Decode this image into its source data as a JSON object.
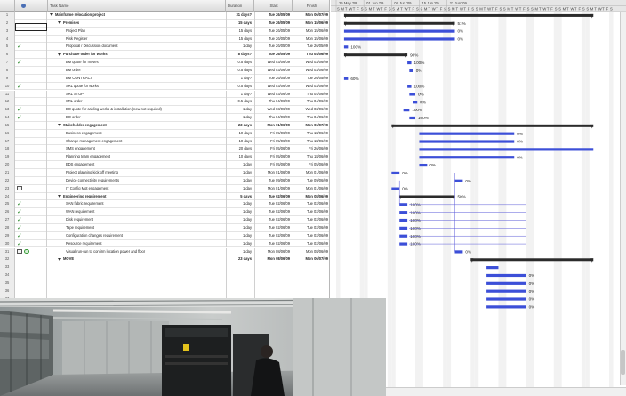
{
  "table": {
    "headers": {
      "indicators": "",
      "name": "Task Name",
      "duration": "Duration",
      "start": "Start",
      "finish": "Finish"
    },
    "rows": [
      {
        "id": "1",
        "ind": "",
        "level": 0,
        "summary": true,
        "collapse": true,
        "name": "Mainframe relocation project",
        "dur": "31 days?",
        "start": "Tue 26/05/09",
        "finish": "Mon 06/07/09"
      },
      {
        "id": "2",
        "ind": "",
        "level": 1,
        "summary": true,
        "collapse": true,
        "name": "Premises",
        "dur": "15 days",
        "start": "Tue 26/05/09",
        "finish": "Mon 15/06/09"
      },
      {
        "id": "3",
        "ind": "",
        "level": 2,
        "summary": false,
        "name": "Project Plan",
        "dur": "15 days",
        "start": "Tue 26/05/09",
        "finish": "Mon 15/06/09"
      },
      {
        "id": "4",
        "ind": "",
        "level": 2,
        "summary": false,
        "name": "Risk Register",
        "dur": "15 days",
        "start": "Tue 26/05/09",
        "finish": "Mon 15/06/09"
      },
      {
        "id": "5",
        "ind": "check",
        "level": 2,
        "summary": false,
        "name": "Proposal / Discussion document",
        "dur": "1 day",
        "start": "Tue 26/05/09",
        "finish": "Tue 26/05/09"
      },
      {
        "id": "6",
        "ind": "",
        "level": 1,
        "summary": true,
        "collapse": true,
        "name": "Purchase order for works",
        "dur": "8 days?",
        "start": "Tue 26/05/09",
        "finish": "Thu 04/06/09"
      },
      {
        "id": "7",
        "ind": "check",
        "level": 2,
        "summary": false,
        "name": "BM quote for moves",
        "dur": "0.5 days",
        "start": "Wed 03/06/09",
        "finish": "Wed 03/06/09"
      },
      {
        "id": "8",
        "ind": "",
        "level": 2,
        "summary": false,
        "name": "BM order",
        "dur": "0.5 days",
        "start": "Wed 03/06/09",
        "finish": "Wed 03/06/09"
      },
      {
        "id": "9",
        "ind": "",
        "level": 2,
        "summary": false,
        "name": "BM CONTRACT",
        "dur": "1 day?",
        "start": "Tue 26/05/09",
        "finish": "Tue 26/05/09"
      },
      {
        "id": "10",
        "ind": "check",
        "level": 2,
        "summary": false,
        "name": "SRL quote for works",
        "dur": "0.5 days",
        "start": "Wed 03/06/09",
        "finish": "Wed 03/06/09"
      },
      {
        "id": "11",
        "ind": "",
        "level": 2,
        "summary": false,
        "name": "SRL STOP",
        "dur": "1 day?",
        "start": "Wed 03/06/09",
        "finish": "Thu 04/06/09"
      },
      {
        "id": "12",
        "ind": "",
        "level": 2,
        "summary": false,
        "name": "SRL order",
        "dur": "0.5 days",
        "start": "Thu 04/06/09",
        "finish": "Thu 04/06/09"
      },
      {
        "id": "13",
        "ind": "check",
        "level": 2,
        "summary": false,
        "name": "EO quote for cabling works & installation (now not required)",
        "dur": "1 day",
        "start": "Wed 03/06/09",
        "finish": "Wed 03/06/09"
      },
      {
        "id": "14",
        "ind": "check",
        "level": 2,
        "summary": false,
        "name": "EO order",
        "dur": "1 day",
        "start": "Thu 04/06/09",
        "finish": "Thu 04/06/09"
      },
      {
        "id": "15",
        "ind": "",
        "level": 1,
        "summary": true,
        "collapse": true,
        "name": "Stakeholder engagement",
        "dur": "23 days",
        "start": "Mon 01/06/09",
        "finish": "Mon 06/07/09"
      },
      {
        "id": "16",
        "ind": "",
        "level": 2,
        "summary": false,
        "name": "Business engagement",
        "dur": "10 days",
        "start": "Fri 05/06/09",
        "finish": "Thu 18/06/09"
      },
      {
        "id": "17",
        "ind": "",
        "level": 2,
        "summary": false,
        "name": "Change management engagement",
        "dur": "10 days",
        "start": "Fri 05/06/09",
        "finish": "Thu 18/06/09"
      },
      {
        "id": "18",
        "ind": "",
        "level": 2,
        "summary": false,
        "name": "SMS engagement",
        "dur": "20 days",
        "start": "Fri 05/06/09",
        "finish": "Fri 26/06/09"
      },
      {
        "id": "19",
        "ind": "",
        "level": 2,
        "summary": false,
        "name": "Planning team engagement",
        "dur": "10 days",
        "start": "Fri 05/06/09",
        "finish": "Thu 18/06/09"
      },
      {
        "id": "20",
        "ind": "",
        "level": 2,
        "summary": false,
        "name": "EDS engagement",
        "dur": "1 day",
        "start": "Fri 05/06/09",
        "finish": "Fri 05/06/09"
      },
      {
        "id": "21",
        "ind": "",
        "level": 2,
        "summary": false,
        "name": "Project planning kick off meeting",
        "dur": "1 day",
        "start": "Mon 01/06/09",
        "finish": "Mon 01/06/09"
      },
      {
        "id": "22",
        "ind": "",
        "level": 2,
        "summary": false,
        "name": "Device connectivity requirements",
        "dur": "1 day",
        "start": "Tue 09/06/09",
        "finish": "Tue 09/06/09"
      },
      {
        "id": "23",
        "ind": "note",
        "level": 2,
        "summary": false,
        "name": "IT Config Mgt engagement",
        "dur": "1 day",
        "start": "Mon 01/06/09",
        "finish": "Mon 01/06/09"
      },
      {
        "id": "24",
        "ind": "",
        "level": 1,
        "summary": true,
        "collapse": true,
        "name": "Engineering  requirement",
        "dur": "5 days",
        "start": "Tue 02/06/09",
        "finish": "Mon 08/06/09"
      },
      {
        "id": "25",
        "ind": "check",
        "level": 2,
        "summary": false,
        "name": "SAN fabric requirement",
        "dur": "1 day",
        "start": "Tue 02/06/09",
        "finish": "Tue 02/06/09"
      },
      {
        "id": "26",
        "ind": "check",
        "level": 2,
        "summary": false,
        "name": "WAN requirement",
        "dur": "1 day",
        "start": "Tue 02/06/09",
        "finish": "Tue 02/06/09"
      },
      {
        "id": "27",
        "ind": "check",
        "level": 2,
        "summary": false,
        "name": "Disk requirement",
        "dur": "1 day",
        "start": "Tue 02/06/09",
        "finish": "Tue 02/06/09"
      },
      {
        "id": "28",
        "ind": "check",
        "level": 2,
        "summary": false,
        "name": "Tape requirement",
        "dur": "1 day",
        "start": "Tue 02/06/09",
        "finish": "Tue 02/06/09"
      },
      {
        "id": "29",
        "ind": "check",
        "level": 2,
        "summary": false,
        "name": "Configuration changes requirement",
        "dur": "1 day",
        "start": "Tue 02/06/09",
        "finish": "Tue 02/06/09"
      },
      {
        "id": "30",
        "ind": "check",
        "level": 2,
        "summary": false,
        "name": "Resource requirement",
        "dur": "1 day",
        "start": "Tue 02/06/09",
        "finish": "Tue 02/06/09"
      },
      {
        "id": "31",
        "ind": "notelink",
        "level": 2,
        "summary": false,
        "name": "Visual run-run to confirm location power and floor",
        "dur": "1 day",
        "start": "Mon 08/06/09",
        "finish": "Mon 08/06/09"
      },
      {
        "id": "32",
        "ind": "",
        "level": 1,
        "summary": true,
        "collapse": true,
        "name": "MOVE",
        "dur": "23 days",
        "start": "Mon 08/06/09",
        "finish": "Mon 06/07/09"
      },
      {
        "id": "33",
        "ind": "",
        "level": 2,
        "summary": false,
        "name": "",
        "dur": "",
        "start": "",
        "finish": ""
      },
      {
        "id": "34",
        "ind": "",
        "level": 2,
        "summary": false,
        "name": "",
        "dur": "",
        "start": "",
        "finish": ""
      },
      {
        "id": "35",
        "ind": "",
        "level": 2,
        "summary": false,
        "name": "",
        "dur": "",
        "start": "",
        "finish": ""
      },
      {
        "id": "36",
        "ind": "",
        "level": 2,
        "summary": false,
        "name": "",
        "dur": "",
        "start": "",
        "finish": ""
      },
      {
        "id": "37",
        "ind": "",
        "level": 2,
        "summary": false,
        "name": "",
        "dur": "",
        "start": "",
        "finish": ""
      },
      {
        "id": "38",
        "ind": "",
        "level": 2,
        "summary": false,
        "name": "",
        "dur": "",
        "start": "",
        "finish": ""
      },
      {
        "id": "39",
        "ind": "",
        "level": 2,
        "summary": false,
        "name": "",
        "dur": "",
        "start": "",
        "finish": ""
      },
      {
        "id": "40",
        "ind": "",
        "level": 2,
        "summary": false,
        "name": "",
        "dur": "",
        "start": "",
        "finish": ""
      },
      {
        "id": "41",
        "ind": "",
        "level": 2,
        "summary": false,
        "name": "",
        "dur": "",
        "start": "",
        "finish": ""
      },
      {
        "id": "42",
        "ind": "",
        "level": 2,
        "summary": false,
        "name": "",
        "dur": "",
        "start": "",
        "finish": ""
      },
      {
        "id": "43",
        "ind": "",
        "level": 2,
        "summary": false,
        "name": "",
        "dur": "",
        "start": "",
        "finish": ""
      },
      {
        "id": "44",
        "ind": "",
        "level": 2,
        "summary": false,
        "name": "",
        "dur": "",
        "start": "",
        "finish": ""
      },
      {
        "id": "45",
        "ind": "",
        "level": 2,
        "summary": false,
        "name": "",
        "dur": "",
        "start": "",
        "finish": ""
      },
      {
        "id": "46",
        "ind": "",
        "level": 2,
        "summary": false,
        "name": "",
        "dur": "",
        "start": "",
        "finish": ""
      },
      {
        "id": "47",
        "ind": "",
        "level": 2,
        "summary": false,
        "name": "",
        "dur": "",
        "start": "",
        "finish": ""
      }
    ]
  },
  "gantt": {
    "weeks": [
      "25 May '09",
      "01 Jun '09",
      "08 Jun '09",
      "15 Jun '09",
      "22 Jun '09"
    ],
    "day_letters": [
      "S",
      "M",
      "T",
      "W",
      "T",
      "F",
      "S"
    ],
    "bars": [
      {
        "row": 1,
        "type": "summary",
        "start": 2,
        "end": 65,
        "label": ""
      },
      {
        "row": 2,
        "type": "summary",
        "start": 2,
        "end": 30,
        "label": "51%"
      },
      {
        "row": 3,
        "type": "task",
        "start": 2,
        "end": 30,
        "label": "0%"
      },
      {
        "row": 4,
        "type": "task",
        "start": 2,
        "end": 30,
        "label": "0%"
      },
      {
        "row": 5,
        "type": "task",
        "start": 2,
        "end": 3,
        "label": "100%"
      },
      {
        "row": 6,
        "type": "summary",
        "start": 2,
        "end": 18,
        "label": "90%"
      },
      {
        "row": 7,
        "type": "task",
        "start": 18,
        "end": 19,
        "label": "100%"
      },
      {
        "row": 8,
        "type": "task",
        "start": 18.5,
        "end": 19.5,
        "label": "0%"
      },
      {
        "row": 9,
        "type": "task",
        "start": 2,
        "end": 3,
        "label": "60%"
      },
      {
        "row": 10,
        "type": "task",
        "start": 18,
        "end": 19,
        "label": "100%"
      },
      {
        "row": 11,
        "type": "task",
        "start": 18.5,
        "end": 20,
        "label": "0%"
      },
      {
        "row": 12,
        "type": "task",
        "start": 19.5,
        "end": 20.5,
        "label": "0%"
      },
      {
        "row": 13,
        "type": "task",
        "start": 17,
        "end": 18.5,
        "label": "100%"
      },
      {
        "row": 14,
        "type": "task",
        "start": 18.5,
        "end": 20,
        "label": "100%"
      },
      {
        "row": 15,
        "type": "summary",
        "start": 14,
        "end": 65,
        "label": ""
      },
      {
        "row": 16,
        "type": "task",
        "start": 21,
        "end": 45,
        "label": "0%"
      },
      {
        "row": 17,
        "type": "task",
        "start": 21,
        "end": 45,
        "label": "0%"
      },
      {
        "row": 18,
        "type": "task",
        "start": 21,
        "end": 65,
        "label": ""
      },
      {
        "row": 19,
        "type": "task",
        "start": 21,
        "end": 45,
        "label": "0%"
      },
      {
        "row": 20,
        "type": "task",
        "start": 21,
        "end": 23,
        "label": "0%"
      },
      {
        "row": 21,
        "type": "task",
        "start": 14,
        "end": 16,
        "label": "0%"
      },
      {
        "row": 22,
        "type": "task",
        "start": 30,
        "end": 32,
        "label": "0%"
      },
      {
        "row": 23,
        "type": "task",
        "start": 14,
        "end": 16,
        "label": "0%"
      },
      {
        "row": 24,
        "type": "summary",
        "start": 16,
        "end": 30,
        "label": "50%"
      },
      {
        "row": 25,
        "type": "task",
        "start": 16,
        "end": 18,
        "label": "100%"
      },
      {
        "row": 26,
        "type": "task",
        "start": 16,
        "end": 18,
        "label": "100%"
      },
      {
        "row": 27,
        "type": "task",
        "start": 16,
        "end": 18,
        "label": "100%"
      },
      {
        "row": 28,
        "type": "task",
        "start": 16,
        "end": 18,
        "label": "100%"
      },
      {
        "row": 29,
        "type": "task",
        "start": 16,
        "end": 18,
        "label": "100%"
      },
      {
        "row": 30,
        "type": "task",
        "start": 16,
        "end": 18,
        "label": "100%"
      },
      {
        "row": 31,
        "type": "task",
        "start": 30,
        "end": 32,
        "label": "0%"
      },
      {
        "row": 32,
        "type": "summary",
        "start": 34,
        "end": 65,
        "label": ""
      },
      {
        "row": 33,
        "type": "task",
        "start": 38,
        "end": 41,
        "label": ""
      },
      {
        "row": 34,
        "type": "task",
        "start": 38,
        "end": 48,
        "label": "0%"
      },
      {
        "row": 35,
        "type": "task",
        "start": 38,
        "end": 48,
        "label": "0%"
      },
      {
        "row": 36,
        "type": "task",
        "start": 38,
        "end": 48,
        "label": "0%"
      },
      {
        "row": 37,
        "type": "task",
        "start": 38,
        "end": 48,
        "label": "0%"
      },
      {
        "row": 38,
        "type": "task",
        "start": 38,
        "end": 48,
        "label": "0%"
      }
    ]
  },
  "colors": {
    "bar": "#3c4fd8",
    "summary": "#2b2b2b",
    "link": "#5a5ad8",
    "weekend": "#f2f2f2",
    "check": "#2e8b2e"
  }
}
